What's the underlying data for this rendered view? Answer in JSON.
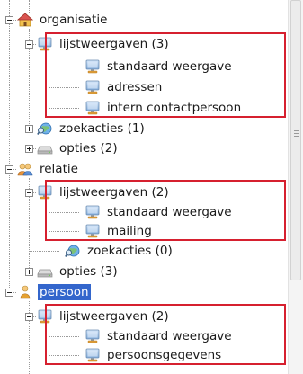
{
  "tree": {
    "organisatie": {
      "label": "organisatie",
      "lijstweergaven": {
        "label": "lijstweergaven (3)",
        "items": [
          "standaard weergave",
          "adressen",
          "intern contactpersoon"
        ]
      },
      "zoekacties": {
        "label": "zoekacties (1)"
      },
      "opties": {
        "label": "opties (2)"
      }
    },
    "relatie": {
      "label": "relatie",
      "lijstweergaven": {
        "label": "lijstweergaven (2)",
        "items": [
          "standaard weergave",
          "mailing"
        ]
      },
      "zoekacties": {
        "label": "zoekacties (0)"
      },
      "opties": {
        "label": "opties (3)"
      }
    },
    "persoon": {
      "label": "persoon",
      "lijstweergaven": {
        "label": "lijstweergaven (2)",
        "items": [
          "standaard weergave",
          "persoonsgegevens"
        ]
      }
    }
  },
  "colors": {
    "highlight_border": "#d6202f",
    "selection": "#3366cc"
  },
  "icons": {
    "organisatie": "house-icon",
    "relatie": "people-icon",
    "persoon": "person-icon",
    "lijstweergaven": "monitor-icon",
    "zoekacties": "search-globe-icon",
    "opties": "options-drive-icon"
  }
}
